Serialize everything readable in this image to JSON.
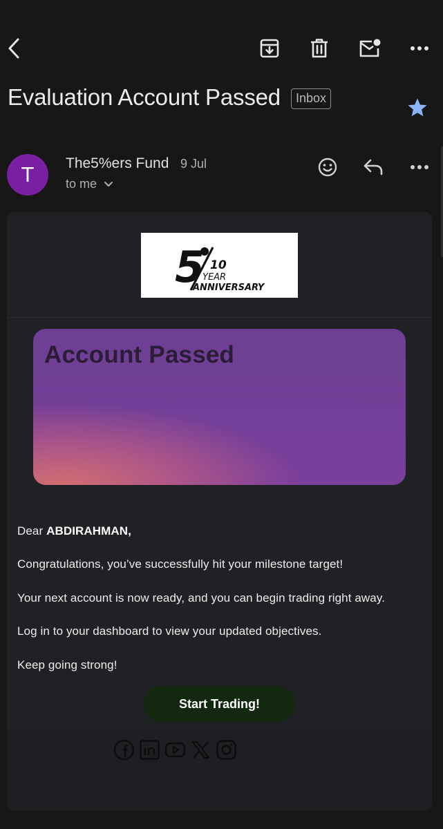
{
  "toolbar": {
    "back": "back-arrow-icon",
    "archive": "archive-icon",
    "delete": "trash-icon",
    "mark_unread": "mark-unread-icon",
    "more": "more-dots-icon"
  },
  "message": {
    "subject": "Evaluation Account Passed",
    "label": "Inbox",
    "starred": true,
    "star_color": "#8ab4f8"
  },
  "sender": {
    "avatar_letter": "T",
    "avatar_color": "#7a1fa2",
    "name": "The5%ers Fund",
    "date": "9 Jul",
    "recipient": "to me"
  },
  "email": {
    "logo": {
      "numeral": "5",
      "years": "10",
      "line1": "YEAR",
      "line2": "ANNIVERSARY"
    },
    "hero_title": "Account Passed",
    "greeting_prefix": "Dear ",
    "greeting_name": "ABDIRAHMAN,",
    "paragraphs": [
      "Congratulations, you’ve successfully hit your milestone target!",
      "Your next account is now ready, and you can begin trading right away.",
      "Log in to your dashboard to view your updated objectives.",
      "Keep going strong!"
    ],
    "cta_label": "Start Trading!",
    "social": [
      "facebook-icon",
      "linkedin-icon",
      "youtube-icon",
      "x-icon",
      "instagram-icon"
    ]
  }
}
